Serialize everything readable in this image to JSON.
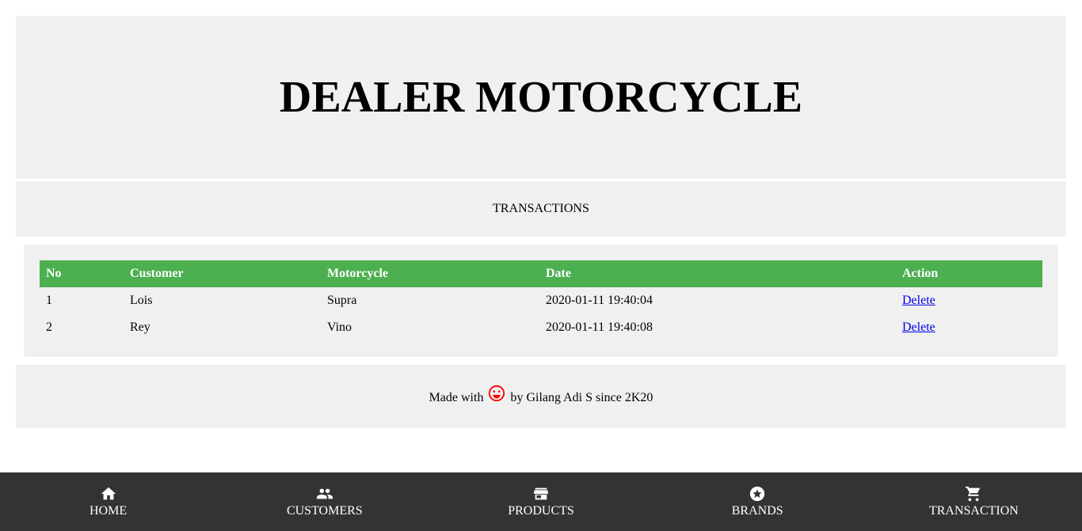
{
  "header": {
    "title": "DEALER MOTORCYCLE"
  },
  "subheader": {
    "title": "TRANSACTIONS"
  },
  "table": {
    "columns": [
      "No",
      "Customer",
      "Motorcycle",
      "Date",
      "Action"
    ],
    "rows": [
      {
        "no": "1",
        "customer": "Lois",
        "motorcycle": "Supra",
        "date": "2020-01-11 19:40:04",
        "action": "Delete"
      },
      {
        "no": "2",
        "customer": "Rey",
        "motorcycle": "Vino",
        "date": "2020-01-11 19:40:08",
        "action": "Delete"
      }
    ]
  },
  "footer": {
    "prefix": "Made with",
    "icon": "smile-icon",
    "suffix": "by Gilang Adi S since 2K20"
  },
  "nav": [
    {
      "label": "HOME",
      "icon": "home-icon"
    },
    {
      "label": "CUSTOMERS",
      "icon": "people-icon"
    },
    {
      "label": "PRODUCTS",
      "icon": "store-icon"
    },
    {
      "label": "BRANDS",
      "icon": "star-circle-icon"
    },
    {
      "label": "TRANSACTION",
      "icon": "cart-icon"
    }
  ],
  "colors": {
    "accent": "#4caf50",
    "nav_bg": "#333333",
    "panel_bg": "#f0f0f0",
    "smile": "#ff0000"
  }
}
